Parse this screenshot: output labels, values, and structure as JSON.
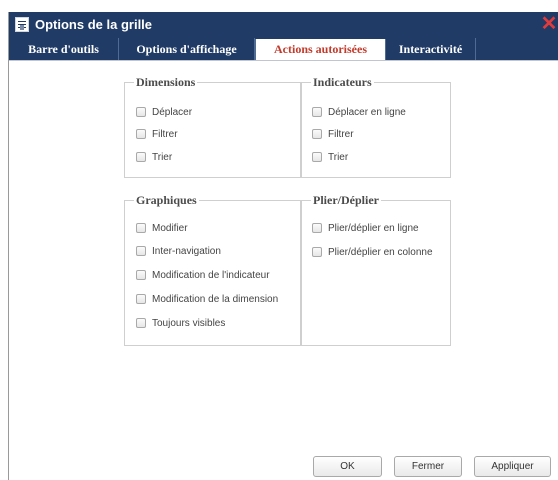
{
  "window": {
    "title": "Options de la grille",
    "icon": "grid-options-icon",
    "close_icon": "close-icon"
  },
  "tabs": [
    {
      "label": "Barre d'outils",
      "active": false
    },
    {
      "label": "Options d'affichage",
      "active": false
    },
    {
      "label": "Actions autorisées",
      "active": true
    },
    {
      "label": "Interactivité",
      "active": false
    }
  ],
  "groups": {
    "dimensions": {
      "legend": "Dimensions",
      "options": [
        {
          "label": "Déplacer",
          "checked": false
        },
        {
          "label": "Filtrer",
          "checked": false
        },
        {
          "label": "Trier",
          "checked": false
        }
      ]
    },
    "indicateurs": {
      "legend": "Indicateurs",
      "options": [
        {
          "label": "Déplacer en ligne",
          "checked": false
        },
        {
          "label": "Filtrer",
          "checked": false
        },
        {
          "label": "Trier",
          "checked": false
        }
      ]
    },
    "graphiques": {
      "legend": "Graphiques",
      "options": [
        {
          "label": "Modifier",
          "checked": false
        },
        {
          "label": "Inter-navigation",
          "checked": false
        },
        {
          "label": "Modification de l'indicateur",
          "checked": false
        },
        {
          "label": "Modification de la dimension",
          "checked": false
        },
        {
          "label": "Toujours visibles",
          "checked": false
        }
      ]
    },
    "plier": {
      "legend": "Plier/Déplier",
      "options": [
        {
          "label": "Plier/déplier en ligne",
          "checked": false
        },
        {
          "label": "Plier/déplier en colonne",
          "checked": false
        }
      ]
    }
  },
  "buttons": {
    "ok": "OK",
    "close": "Fermer",
    "apply": "Appliquer"
  },
  "colors": {
    "titlebar": "#1f3b66",
    "active_tab_text": "#c23a2a",
    "close_icon": "#e23b3b"
  }
}
